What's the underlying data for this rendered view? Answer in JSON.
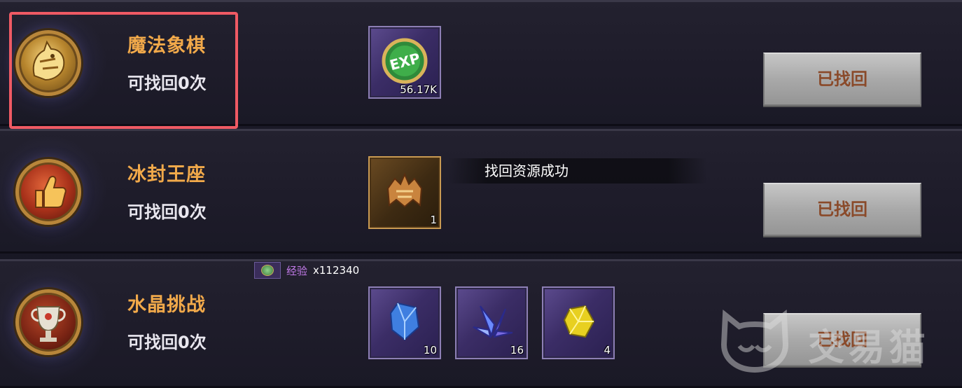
{
  "rows": [
    {
      "title": "魔法象棋",
      "count_text": "可找回0次",
      "medal_icon": "golden-dragon-head-icon",
      "rewards": [
        {
          "icon": "exp-coin-icon",
          "qty": "56.17K"
        }
      ],
      "button_label": "已找回"
    },
    {
      "title": "冰封王座",
      "count_text": "可找回0次",
      "medal_icon": "thumbs-up-icon",
      "rewards": [
        {
          "icon": "golden-helmet-icon",
          "qty": "1"
        }
      ],
      "button_label": "已找回"
    },
    {
      "title": "水晶挑战",
      "count_text": "可找回0次",
      "medal_icon": "trophy-cup-icon",
      "rewards": [
        {
          "icon": "blue-crystal-icon",
          "qty": "10"
        },
        {
          "icon": "purple-crystal-cluster-icon",
          "qty": "16"
        },
        {
          "icon": "gold-crystal-icon",
          "qty": "4"
        }
      ],
      "button_label": "已找回"
    }
  ],
  "toast": {
    "text": "找回资源成功"
  },
  "exp_tip": {
    "label": "经验",
    "value": "x112340"
  },
  "watermark": {
    "text": "交易猫"
  },
  "colors": {
    "title": "#f1a94a",
    "button_text": "#8a4a2a",
    "highlight": "#ef5a64",
    "exp_label": "#c17ae8"
  }
}
